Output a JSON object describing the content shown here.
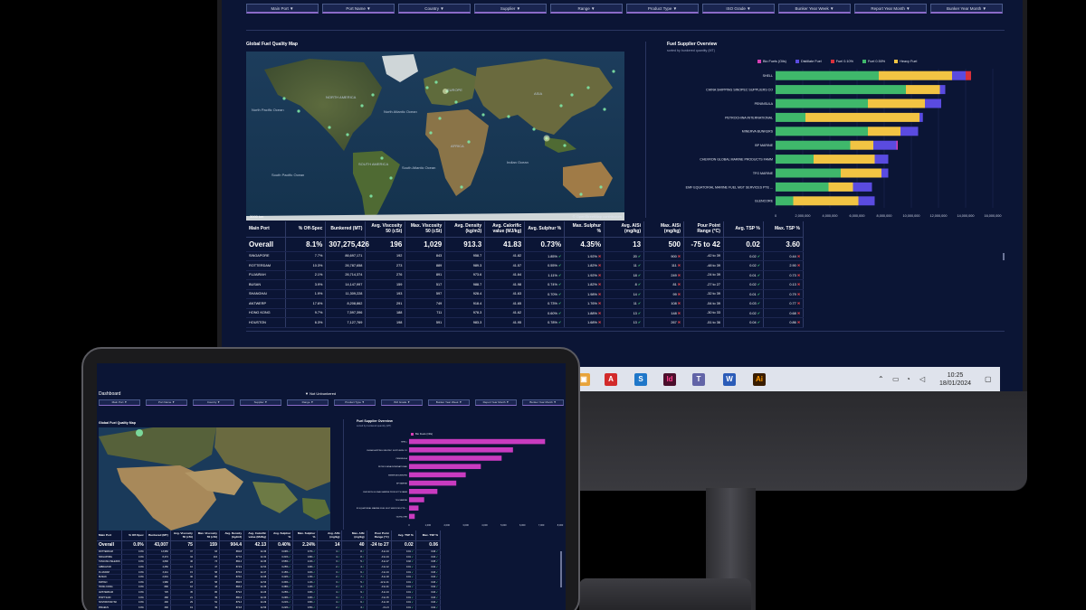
{
  "filters": [
    "Main Port ▼",
    "Port Name ▼",
    "Country ▼",
    "Supplier ▼",
    "Range ▼",
    "Product Type ▼",
    "ISO Grade ▼",
    "Bunker Year Week ▼",
    "Report Year Month ▼",
    "Bunker Year Month ▼"
  ],
  "map": {
    "title": "Global Fuel Quality Map",
    "credit": "© OpenStreetMap contributors",
    "scale": "3000 km",
    "labels": [
      "North Pacific Ocean",
      "NORTH AMERICA",
      "North Atlantic Ocean",
      "EUROPE",
      "ASIA",
      "AFRICA",
      "SOUTH AMERICA",
      "South Atlantic Ocean",
      "South Pacific Ocean",
      "Indian Ocean"
    ]
  },
  "supplier": {
    "title": "Fuel Supplier Overview",
    "subtitle": "sorted by bunkered quantity (MT)",
    "legend": [
      {
        "name": "Bio Fuels (Oils)",
        "color": "#d63fb3"
      },
      {
        "name": "Distillate Fuel",
        "color": "#5a4be0"
      },
      {
        "name": "Fuel 0.10%",
        "color": "#d8303b"
      },
      {
        "name": "Fuel 0.50%",
        "color": "#3fb86b"
      },
      {
        "name": "Heavy Fuel",
        "color": "#f2c443"
      }
    ]
  },
  "chart_data": [
    {
      "type": "bar",
      "orientation": "horizontal",
      "stacked": true,
      "title": "Fuel Supplier Overview",
      "categories": [
        "SHELL",
        "CHINA SHIPPING  SINOPEC SUPPLIERS CO",
        "PENINSULA",
        "PETROCHINA INTERNATIONAL",
        "MINERVA BUNKERS",
        "BP MARINE",
        "CHEVRON GLOBAL MARINE PRODUCTS FAMM",
        "TFG MARINE",
        "EMF EQUATORIAL MARINE FUEL MGT SERVICES PTE ...",
        "GLENCORE"
      ],
      "series": [
        {
          "name": "Fuel 0.50%",
          "values": [
            7600000,
            9600000,
            6800000,
            2200000,
            6800000,
            5500000,
            2800000,
            4800000,
            3900000,
            1300000
          ]
        },
        {
          "name": "Heavy Fuel",
          "values": [
            5400000,
            2500000,
            4200000,
            8400000,
            2400000,
            1700000,
            4500000,
            3000000,
            1800000,
            4800000
          ]
        },
        {
          "name": "Distillate Fuel",
          "values": [
            1000000,
            400000,
            1200000,
            250000,
            1300000,
            1700000,
            1000000,
            500000,
            1400000,
            1200000
          ]
        },
        {
          "name": "Fuel 0.10%",
          "values": [
            400000,
            0,
            0,
            0,
            0,
            0,
            0,
            0,
            0,
            0
          ]
        },
        {
          "name": "Bio Fuels (Oils)",
          "values": [
            0,
            0,
            0,
            0,
            0,
            100000,
            0,
            0,
            0,
            0
          ]
        }
      ],
      "x_ticks": [
        "0",
        "2,000,000",
        "4,000,000",
        "6,000,000",
        "8,000,000",
        "10,000,000",
        "12,000,000",
        "14,000,000",
        "16,000,000"
      ],
      "xlim": [
        0,
        16000000
      ]
    },
    {
      "type": "bar",
      "orientation": "horizontal",
      "series": [
        {
          "name": "Bio Fuels (Oils)",
          "values": [
            7200,
            5500,
            4900,
            3800,
            3000,
            2500,
            1500,
            800,
            500,
            300
          ]
        }
      ],
      "x_ticks": [
        "0",
        "1,000",
        "2,000",
        "3,000",
        "4,000",
        "5,000",
        "6,000",
        "7,000",
        "8,000"
      ],
      "xlim": [
        0,
        8000
      ]
    }
  ],
  "table": {
    "headers": [
      "Main Port",
      "% Off-Spec",
      "Bunkered (MT)",
      "Avg. Viscosity 50 (cSt)",
      "Max. Viscosity 50 (cSt)",
      "Avg. Density (kg/m3)",
      "Avg. Calorific value (MJ/kg)",
      "Avg. Sulphur %",
      "Max. Sulphur %",
      "Avg. AlSi (mg/kg)",
      "Max. AlSi (mg/kg)",
      "Pour Point Range (°C)",
      "Avg. TSP %",
      "Max. TSP %"
    ],
    "overall": [
      "Overall",
      "8.1%",
      "307,275,426",
      "196",
      "1,029",
      "913.3",
      "41.83",
      "0.73%",
      "4.35%",
      "13",
      "500",
      "-75 to 42",
      "0.02",
      "3.60"
    ],
    "rows": [
      [
        "SINGAPORE",
        "7.7%",
        "86,697,171",
        "192",
        "843",
        "958.7",
        "41.82",
        "1.85% ✔",
        "1.92% ✖",
        "20 ✔",
        "900 ✖",
        "-42 to 39",
        "0.02 ✔",
        "0.44 ✖"
      ],
      [
        "ROTTERDAM",
        "10.3%",
        "26,787,658",
        "273",
        "889",
        "989.3",
        "41.57",
        "0.55% ✔",
        "1.82% ✖",
        "11 ✔",
        "111 ✖",
        "-48 to 39",
        "0.02 ✔",
        "2.90 ✖"
      ],
      [
        "FUJAIRAH",
        "2.1%",
        "26,714,374",
        "276",
        "891",
        "973.6",
        "41.64",
        "1.11% ✔",
        "1.92% ✖",
        "18 ✔",
        "249 ✖",
        "-24 to 39",
        "0.01 ✔",
        "0.73 ✖"
      ],
      [
        "BUSAN",
        "3.9%",
        "14,147,997",
        "159",
        "517",
        "988.7",
        "41.98",
        "0.74% ✔",
        "1.82% ✖",
        "8 ✔",
        "81 ✖",
        "-27 to 27",
        "0.02 ✔",
        "0.13 ✖"
      ],
      [
        "SHANGHAI",
        "1.9%",
        "11,309,228",
        "193",
        "597",
        "928.4",
        "41.63",
        "0.70% ✔",
        "1.98% ✖",
        "14 ✔",
        "99 ✖",
        "-32 to 39",
        "0.01 ✔",
        "0.79 ✖"
      ],
      [
        "ANTWERP",
        "17.6%",
        "8,208,862",
        "291",
        "749",
        "918.4",
        "41.65",
        "0.73% ✔",
        "1.76% ✖",
        "11 ✔",
        "108 ✖",
        "-54 to 39",
        "0.03 ✔",
        "0.77 ✖"
      ],
      [
        "HONG KONG",
        "9.7%",
        "7,597,396",
        "188",
        "711",
        "978.3",
        "41.62",
        "0.60% ✔",
        "1.88% ✖",
        "13 ✔",
        "148 ✖",
        "-30 to 33",
        "0.02 ✔",
        "0.68 ✖"
      ],
      [
        "HOUSTON",
        "6.3%",
        "7,127,769",
        "198",
        "591",
        "983.3",
        "41.95",
        "0.78% ✔",
        "1.68% ✖",
        "13 ✔",
        "267 ✖",
        "-51 to 36",
        "0.04 ✔",
        "0.86 ✖"
      ]
    ]
  },
  "taskbar": {
    "time": "10:25",
    "date": "18/01/2024"
  },
  "tablet": {
    "title": "Dashboard",
    "center_label": "▼ Not Unbunkered",
    "filters": [
      "Main Port ▼",
      "Port Name ▼",
      "Country ▼",
      "Supplier ▼",
      "Range ▼",
      "Product Type ▼",
      "ISO Grade ▼",
      "Bunker Year Week ▼",
      "Report Year Month ▼",
      "Bunker Year Month ▼"
    ],
    "map_title": "Global Fuel Quality Map",
    "supplier_title": "Fuel Supplier Overview",
    "supplier_sub": "sorted by bunkered quantity (MT)",
    "legend": "Bio Fuels (Oils)",
    "overall": [
      "Overall",
      "0.0%",
      "43,007",
      "75",
      "159",
      "904.4",
      "42.13",
      "0.40%",
      "2.24%",
      "14",
      "40",
      "-24 to 27",
      "0.02",
      "0.06"
    ],
    "rows": [
      [
        "ROTTERDAM",
        "0.0%",
        "13,950",
        "37",
        "93",
        "882.8",
        "42.36",
        "0.09% ✔",
        "0.7% ✔",
        "4 ✔",
        "8 ✔",
        "-6 to 24",
        "0.01 ✔",
        "0.06 ✔"
      ],
      [
        "SINGAPORE",
        "0.0%",
        "8,474",
        "34",
        "104",
        "877.6",
        "42.32",
        "0.31% ✔",
        "0.8% ✔",
        "4 ✔",
        "8 ✔",
        "-9 to 24",
        "0.01 ✔",
        "0.04 ✔"
      ],
      [
        "TANJUNG PELEPAS",
        "0.0%",
        "4,800",
        "46",
        "73",
        "882.4",
        "42.35",
        "0.55% ✔",
        "2.1% ✔",
        "3 ✔",
        "5 ✔",
        "-6 to 27",
        "0.02 ✔",
        "0.05 ✔"
      ],
      [
        "GIBRALTAR",
        "0.0%",
        "4,250",
        "16",
        "47",
        "874.9",
        "42.54",
        "0.25% ✔",
        "0.9% ✔",
        "2 ✔",
        "4 ✔",
        "-3 to 12",
        "0.01 ✔",
        "0.02 ✔"
      ],
      [
        "FUJAIRAH",
        "0.0%",
        "3,241",
        "15",
        "58",
        "876.6",
        "42.47",
        "0.15% ✔",
        "0.4% ✔",
        "3 ✔",
        "6 ✔",
        "-3 to 24",
        "0.01 ✔",
        "0.03 ✔"
      ],
      [
        "BUSAN",
        "0.0%",
        "2,601",
        "36",
        "86",
        "876.0",
        "42.08",
        "0.42% ✔",
        "1.3% ✔",
        "2 ✔",
        "7 ✔",
        "-6 to 18",
        "0.01 ✔",
        "0.04 ✔"
      ],
      [
        "RIZHAO",
        "0.0%",
        "1,980",
        "23",
        "58",
        "882.5",
        "42.53",
        "0.33% ✔",
        "1.1% ✔",
        "3 ✔",
        "5 ✔",
        "-12 to 21",
        "0.01 ✔",
        "0.03 ✔"
      ],
      [
        "HONG KONG",
        "0.0%",
        "896",
        "16",
        "43",
        "883.4",
        "42.36",
        "0.38% ✔",
        "1.2% ✔",
        "2 ✔",
        "4 ✔",
        "-9 to 21",
        "0.01 ✔",
        "0.02 ✔"
      ],
      [
        "AMSTERDAM",
        "0.0%",
        "725",
        "45",
        "86",
        "879.6",
        "42.26",
        "0.25% ✔",
        "0.9% ✔",
        "4 ✔",
        "9 ✔",
        "-6 to 24",
        "0.01 ✔",
        "0.04 ✔"
      ],
      [
        "PORT SAID",
        "0.0%",
        "468",
        "21",
        "39",
        "880.4",
        "42.34",
        "0.29% ✔",
        "0.9% ✔",
        "3 ✔",
        "7 ✔",
        "-3 to 15",
        "0.01 ✔",
        "0.03 ✔"
      ],
      [
        "NOVOROSSIYSK",
        "0.0%",
        "400",
        "29",
        "52",
        "879.4",
        "42.29",
        "0.21% ✔",
        "0.6% ✔",
        "4 ✔",
        "6 ✔",
        "-6 to 18",
        "0.01 ✔",
        "0.04 ✔"
      ],
      [
        "PIRAEUS",
        "0.0%",
        "300",
        "19",
        "39",
        "874.8",
        "42.56",
        "0.22% ✔",
        "0.5% ✔",
        "2 ✔",
        "3 ✔",
        "-3 to 9",
        "0.01 ✔",
        "0.02 ✔"
      ]
    ]
  }
}
